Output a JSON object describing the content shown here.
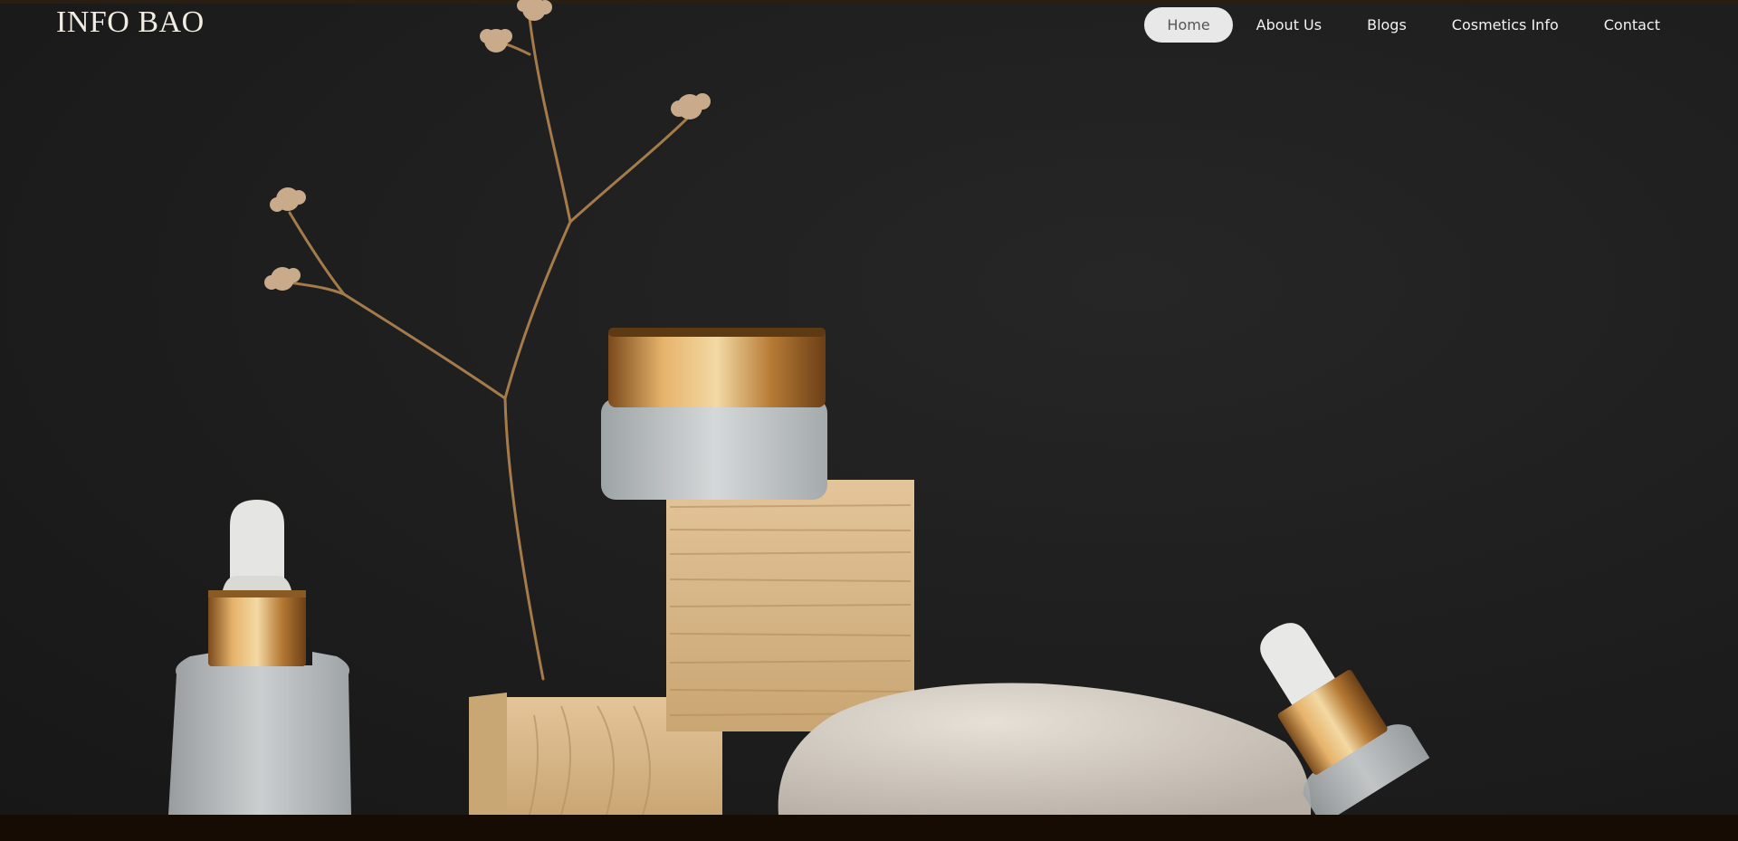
{
  "brand": {
    "name": "INFO BAO"
  },
  "nav": {
    "items": [
      {
        "label": "Home",
        "active": true
      },
      {
        "label": "About Us",
        "active": false
      },
      {
        "label": "Blogs",
        "active": false
      },
      {
        "label": "Cosmetics Info",
        "active": false
      },
      {
        "label": "Contact",
        "active": false
      }
    ]
  },
  "colors": {
    "background": "#1f1f1f",
    "footer": "#160c04",
    "gold": "#c8913f",
    "wood": "#d9b98a",
    "stone": "#d9d3cb",
    "frosted_glass": "#c9cdcf"
  }
}
